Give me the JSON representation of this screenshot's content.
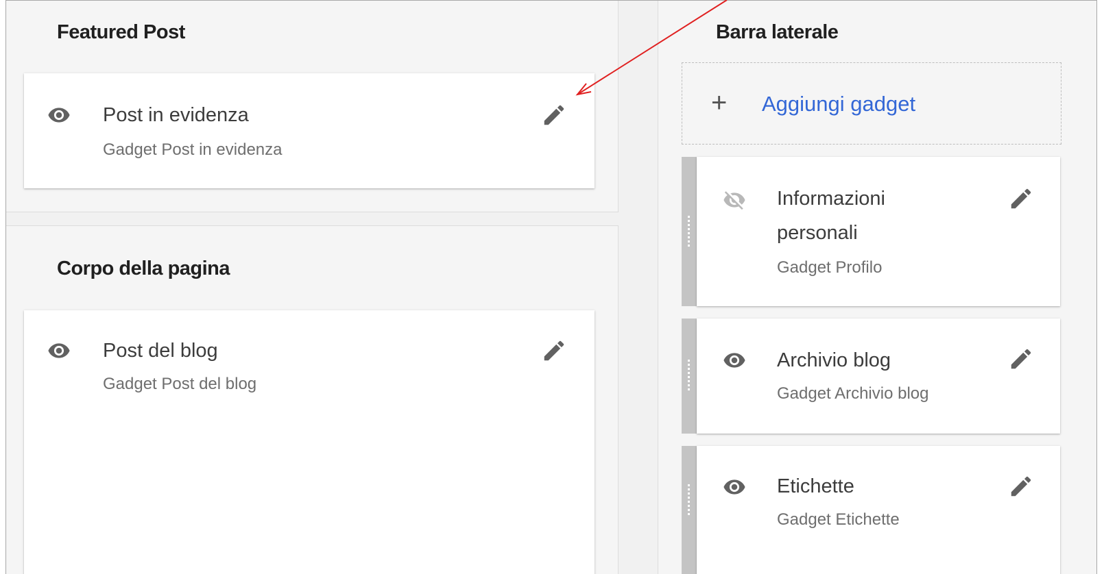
{
  "sections": {
    "featured": {
      "title": "Featured Post"
    },
    "body": {
      "title": "Corpo della pagina"
    },
    "sidebar": {
      "title": "Barra laterale"
    }
  },
  "add_gadget": {
    "label": "Aggiungi gadget",
    "icon": "plus-icon"
  },
  "gadgets": {
    "featured_post": {
      "title": "Post in evidenza",
      "subtitle": "Gadget Post in evidenza",
      "visibility": "visible"
    },
    "blog_posts": {
      "title": "Post del blog",
      "subtitle": "Gadget Post del blog",
      "visibility": "visible"
    },
    "profile": {
      "title_line1": "Informazioni",
      "title_line2": "personali",
      "subtitle": "Gadget Profilo",
      "visibility": "hidden"
    },
    "archive": {
      "title": "Archivio blog",
      "subtitle": "Gadget Archivio blog",
      "visibility": "visible"
    },
    "labels": {
      "title": "Etichette",
      "subtitle": "Gadget Etichette",
      "visibility": "visible"
    }
  },
  "colors": {
    "accent_link": "#3367d6",
    "annotation_arrow": "#e02020",
    "icon_grey": "#616161"
  }
}
